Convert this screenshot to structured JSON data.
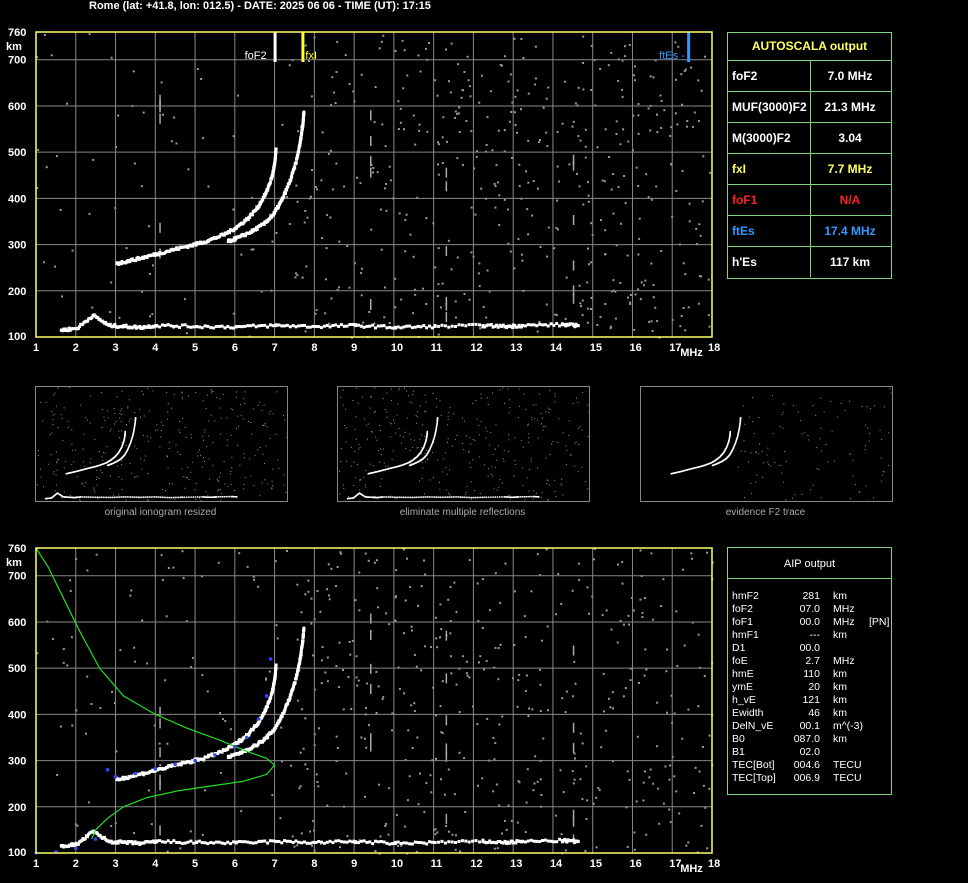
{
  "header": {
    "title": "Rome (lat: +41.8, lon: 012.5) - DATE: 2025 06 06 - TIME (UT): 17:15"
  },
  "colors": {
    "axis": "#ffff66",
    "grid": "#888888",
    "trace": "#ffffff",
    "fxI": "#ffff33",
    "ftEs": "#3399ff",
    "foF1": "#ff2222",
    "profile": "#22dd22",
    "aip_trace": "#3344ff",
    "panel_border": "#7fd47f"
  },
  "chart_data": [
    {
      "type": "scatter",
      "name": "ionogram-top",
      "xlabel": "MHz",
      "ylabel": "km",
      "xlim": [
        1,
        18
      ],
      "ylim": [
        100,
        760
      ],
      "x_ticks": [
        "1",
        "2",
        "3",
        "4",
        "5",
        "6",
        "7",
        "8",
        "9",
        "10",
        "11",
        "12",
        "13",
        "14",
        "15",
        "16",
        "17",
        "18"
      ],
      "y_ticks": [
        "100",
        "200",
        "300",
        "400",
        "500",
        "600",
        "700",
        "760"
      ],
      "grid": true,
      "markers": [
        {
          "label": "foF2",
          "freq": 7.0,
          "color": "#ffffff"
        },
        {
          "label": "fxI",
          "freq": 7.7,
          "color": "#ffff33"
        },
        {
          "label": "ftEs",
          "freq": 17.4,
          "color": "#3399ff"
        }
      ],
      "traces": [
        {
          "series": "O-trace",
          "x": [
            3.0,
            3.3,
            3.7,
            4.1,
            4.5,
            4.9,
            5.3,
            5.7,
            6.0,
            6.3,
            6.55,
            6.75,
            6.9,
            6.97,
            7.0
          ],
          "y": [
            262,
            268,
            276,
            285,
            294,
            302,
            312,
            325,
            340,
            360,
            385,
            415,
            450,
            480,
            510
          ]
        },
        {
          "series": "X-trace",
          "x": [
            5.8,
            6.1,
            6.4,
            6.7,
            6.95,
            7.15,
            7.35,
            7.5,
            7.6,
            7.67,
            7.7
          ],
          "y": [
            310,
            320,
            332,
            348,
            370,
            400,
            440,
            480,
            520,
            560,
            590
          ]
        },
        {
          "series": "Es-trace",
          "x": [
            1.6,
            2.0,
            2.4,
            2.8,
            3.2,
            3.6,
            4.0,
            5.0,
            6.0,
            7.0,
            8.0,
            9.0,
            10.0,
            11.0,
            12.2,
            12.8,
            13.2,
            14.2,
            14.6
          ],
          "y": [
            118,
            122,
            150,
            128,
            126,
            124,
            128,
            126,
            125,
            128,
            126,
            128,
            124,
            126,
            128,
            126,
            128,
            130,
            128
          ]
        }
      ]
    },
    {
      "type": "scatter",
      "name": "ionogram-bottom",
      "xlabel": "MHz",
      "ylabel": "km",
      "xlim": [
        1,
        18
      ],
      "ylim": [
        100,
        760
      ],
      "x_ticks": [
        "1",
        "2",
        "3",
        "4",
        "5",
        "6",
        "7",
        "8",
        "9",
        "10",
        "11",
        "12",
        "13",
        "14",
        "15",
        "16",
        "17",
        "18"
      ],
      "y_ticks": [
        "100",
        "200",
        "300",
        "400",
        "500",
        "600",
        "700",
        "760"
      ],
      "grid": true,
      "traces": [
        {
          "series": "O-trace",
          "x": [
            3.0,
            3.3,
            3.7,
            4.1,
            4.5,
            4.9,
            5.3,
            5.7,
            6.0,
            6.3,
            6.55,
            6.75,
            6.9,
            6.97,
            7.0
          ],
          "y": [
            262,
            268,
            276,
            285,
            294,
            302,
            312,
            325,
            340,
            360,
            385,
            415,
            450,
            480,
            510
          ]
        },
        {
          "series": "X-trace",
          "x": [
            5.8,
            6.1,
            6.4,
            6.7,
            6.95,
            7.15,
            7.35,
            7.5,
            7.6,
            7.67,
            7.7
          ],
          "y": [
            310,
            320,
            332,
            348,
            370,
            400,
            440,
            480,
            520,
            560,
            590
          ]
        },
        {
          "series": "Es-trace",
          "x": [
            1.6,
            2.0,
            2.4,
            2.8,
            3.2,
            3.6,
            4.0,
            5.0,
            6.0,
            7.0,
            8.0,
            9.0,
            10.0,
            11.0,
            12.2,
            12.8,
            13.2,
            14.2,
            14.6
          ],
          "y": [
            118,
            122,
            150,
            128,
            126,
            124,
            128,
            126,
            125,
            128,
            126,
            128,
            124,
            126,
            128,
            126,
            128,
            130,
            128
          ]
        }
      ],
      "profile": {
        "series": "electron-density-profile",
        "x": [
          1.0,
          1.3,
          1.7,
          2.1,
          2.6,
          3.2,
          4.0,
          4.8,
          5.6,
          6.3,
          6.8,
          7.0,
          6.8,
          6.2,
          5.4,
          4.6,
          3.8,
          3.2,
          2.8,
          2.5,
          2.4
        ],
        "y": [
          760,
          720,
          650,
          580,
          500,
          440,
          400,
          370,
          345,
          320,
          305,
          290,
          270,
          255,
          245,
          235,
          220,
          200,
          175,
          150,
          130
        ]
      },
      "aip_trace": {
        "x": [
          1.0,
          1.5,
          2.0,
          2.5,
          2.8,
          3.0,
          3.5,
          4.0,
          4.5,
          5.0,
          5.5,
          6.0,
          6.3,
          6.6,
          6.8,
          6.9
        ],
        "y": [
          100,
          102,
          110,
          130,
          280,
          265,
          272,
          282,
          292,
          300,
          312,
          330,
          350,
          390,
          440,
          520
        ]
      }
    }
  ],
  "autoscala": {
    "title": "AUTOSCALA output",
    "rows": [
      {
        "label": "foF2",
        "value": "7.0 MHz",
        "color": "#ffffff"
      },
      {
        "label": "MUF(3000)F2",
        "value": "21.3 MHz",
        "color": "#ffffff"
      },
      {
        "label": "M(3000)F2",
        "value": "3.04",
        "color": "#ffffff"
      },
      {
        "label": "fxI",
        "value": "7.7 MHz",
        "color": "#ffff66"
      },
      {
        "label": "foF1",
        "value": "N/A",
        "color": "#ff2222"
      },
      {
        "label": "ftEs",
        "value": "17.4 MHz",
        "color": "#3399ff"
      },
      {
        "label": "h'Es",
        "value": "117      km",
        "color": "#ffffff"
      }
    ]
  },
  "thumbnails": [
    {
      "caption": "original ionogram resized"
    },
    {
      "caption": "eliminate multiple reflections"
    },
    {
      "caption": "evidence F2 trace"
    }
  ],
  "aip": {
    "title": "AIP output",
    "rows": [
      {
        "name": "hmF2",
        "value": "281",
        "unit": "km",
        "extra": ""
      },
      {
        "name": "foF2",
        "value": "07.0",
        "unit": "MHz",
        "extra": ""
      },
      {
        "name": "foF1",
        "value": "00.0",
        "unit": "MHz",
        "extra": "[PN]"
      },
      {
        "name": "hmF1",
        "value": "---",
        "unit": "km",
        "extra": ""
      },
      {
        "name": "D1",
        "value": "00.0",
        "unit": "",
        "extra": ""
      },
      {
        "name": "foE",
        "value": "2.7",
        "unit": "MHz",
        "extra": ""
      },
      {
        "name": "hmE",
        "value": "110",
        "unit": "km",
        "extra": ""
      },
      {
        "name": "ymE",
        "value": "20",
        "unit": "km",
        "extra": ""
      },
      {
        "name": "h_vE",
        "value": "121",
        "unit": "km",
        "extra": ""
      },
      {
        "name": "Ewidth",
        "value": "46",
        "unit": "km",
        "extra": ""
      },
      {
        "name": "DelN_vE",
        "value": "00.1",
        "unit": "m^(-3)",
        "extra": ""
      },
      {
        "name": "B0",
        "value": "087.0",
        "unit": "km",
        "extra": ""
      },
      {
        "name": "B1",
        "value": "02.0",
        "unit": "",
        "extra": ""
      },
      {
        "name": "TEC[Bot]",
        "value": "004.6",
        "unit": "TECU",
        "extra": ""
      },
      {
        "name": "TEC[Top]",
        "value": "006.9",
        "unit": "TECU",
        "extra": ""
      }
    ]
  }
}
